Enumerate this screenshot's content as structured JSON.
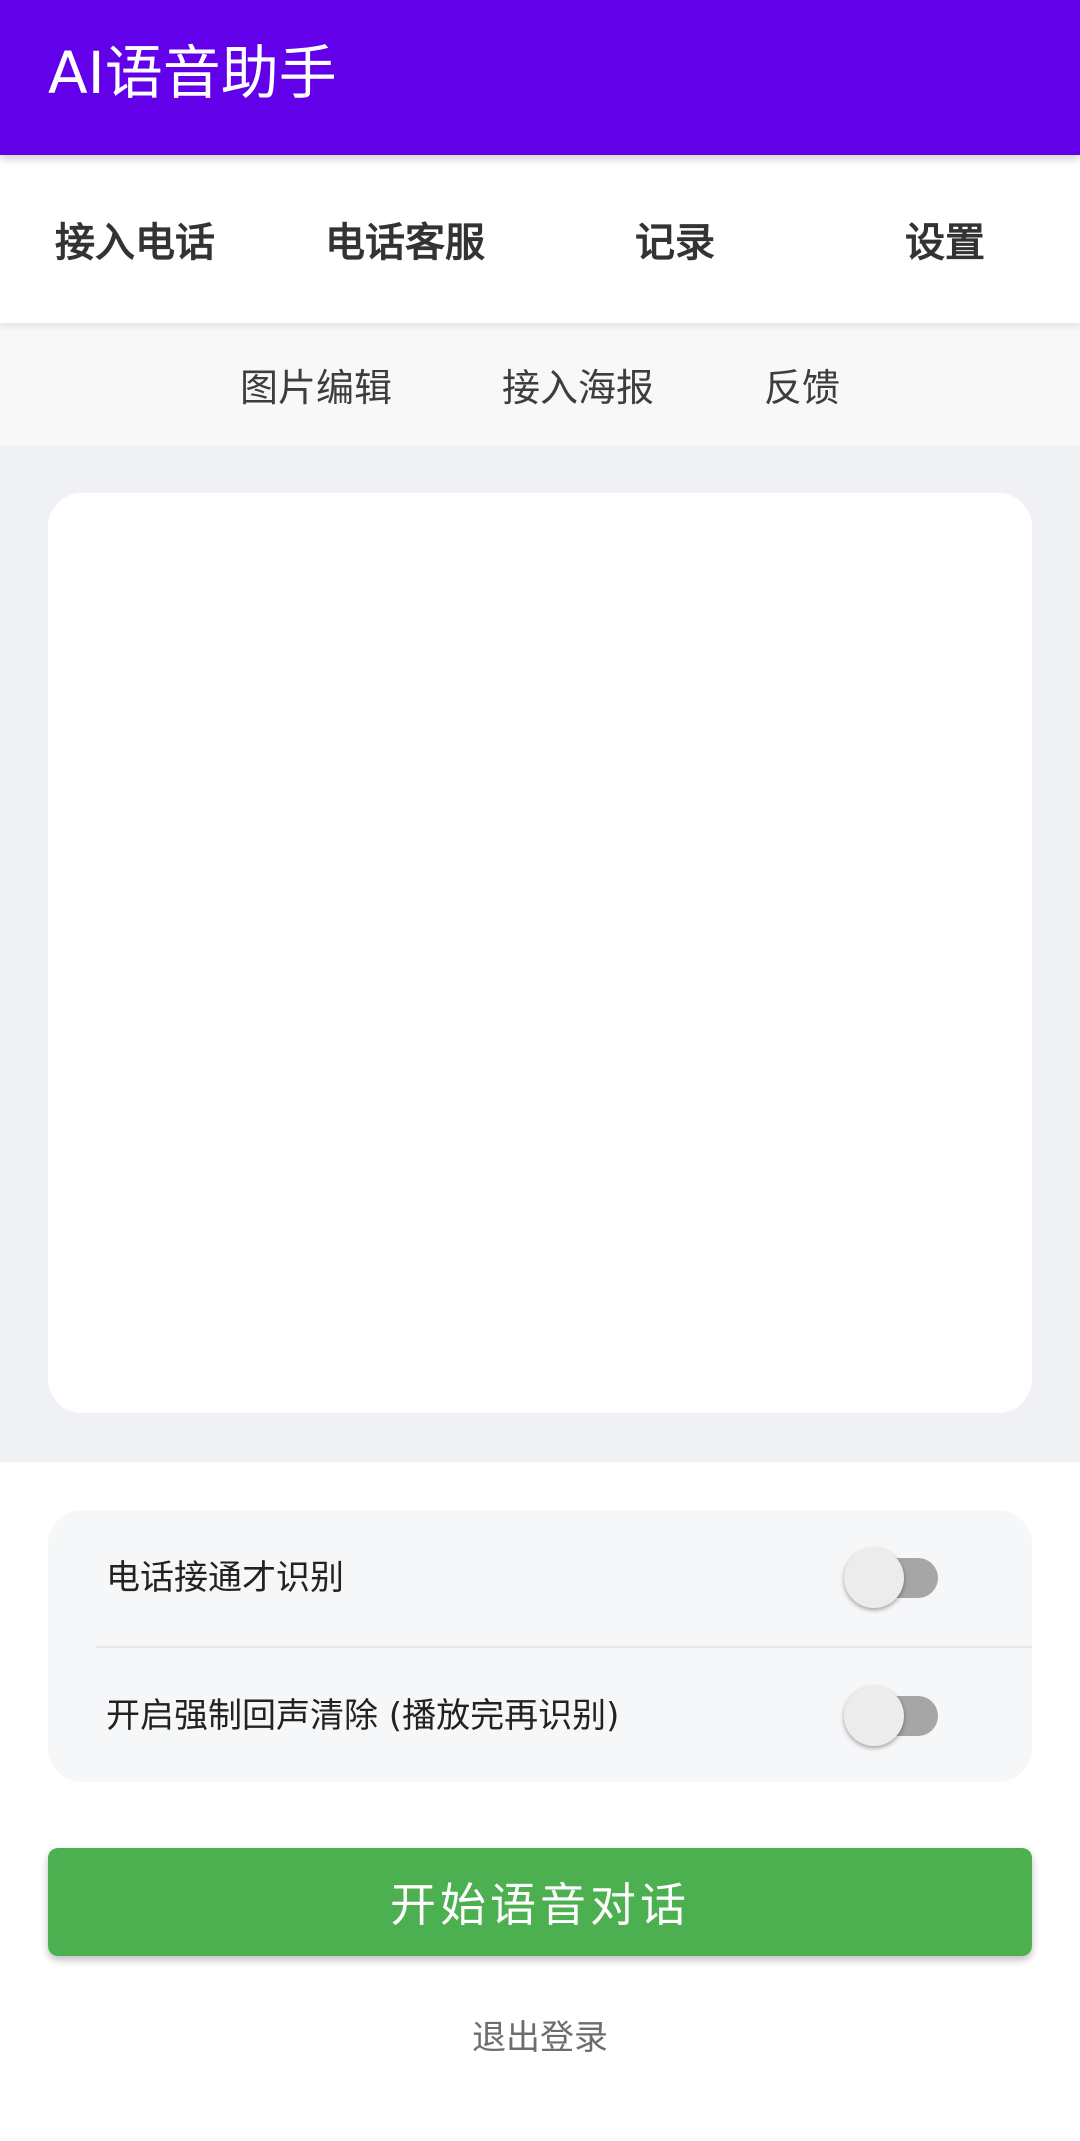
{
  "app": {
    "title": "AI语音助手"
  },
  "tabs": [
    {
      "label": "接入电话"
    },
    {
      "label": "电话客服"
    },
    {
      "label": "记录"
    },
    {
      "label": "设置"
    }
  ],
  "subnav": [
    {
      "label": "图片编辑"
    },
    {
      "label": "接入海报"
    },
    {
      "label": "反馈"
    }
  ],
  "options": [
    {
      "label": "电话接通才识别",
      "enabled": false
    },
    {
      "label": "开启强制回声清除 (播放完再识别)",
      "enabled": false
    }
  ],
  "actions": {
    "start_label": "开始语音对话",
    "logout_label": "退出登录"
  },
  "colors": {
    "appbar": "#6200ea",
    "start_button": "#4caf50",
    "switch_track_off": "#a6a6a6",
    "page_background": "#f0f1f5"
  }
}
